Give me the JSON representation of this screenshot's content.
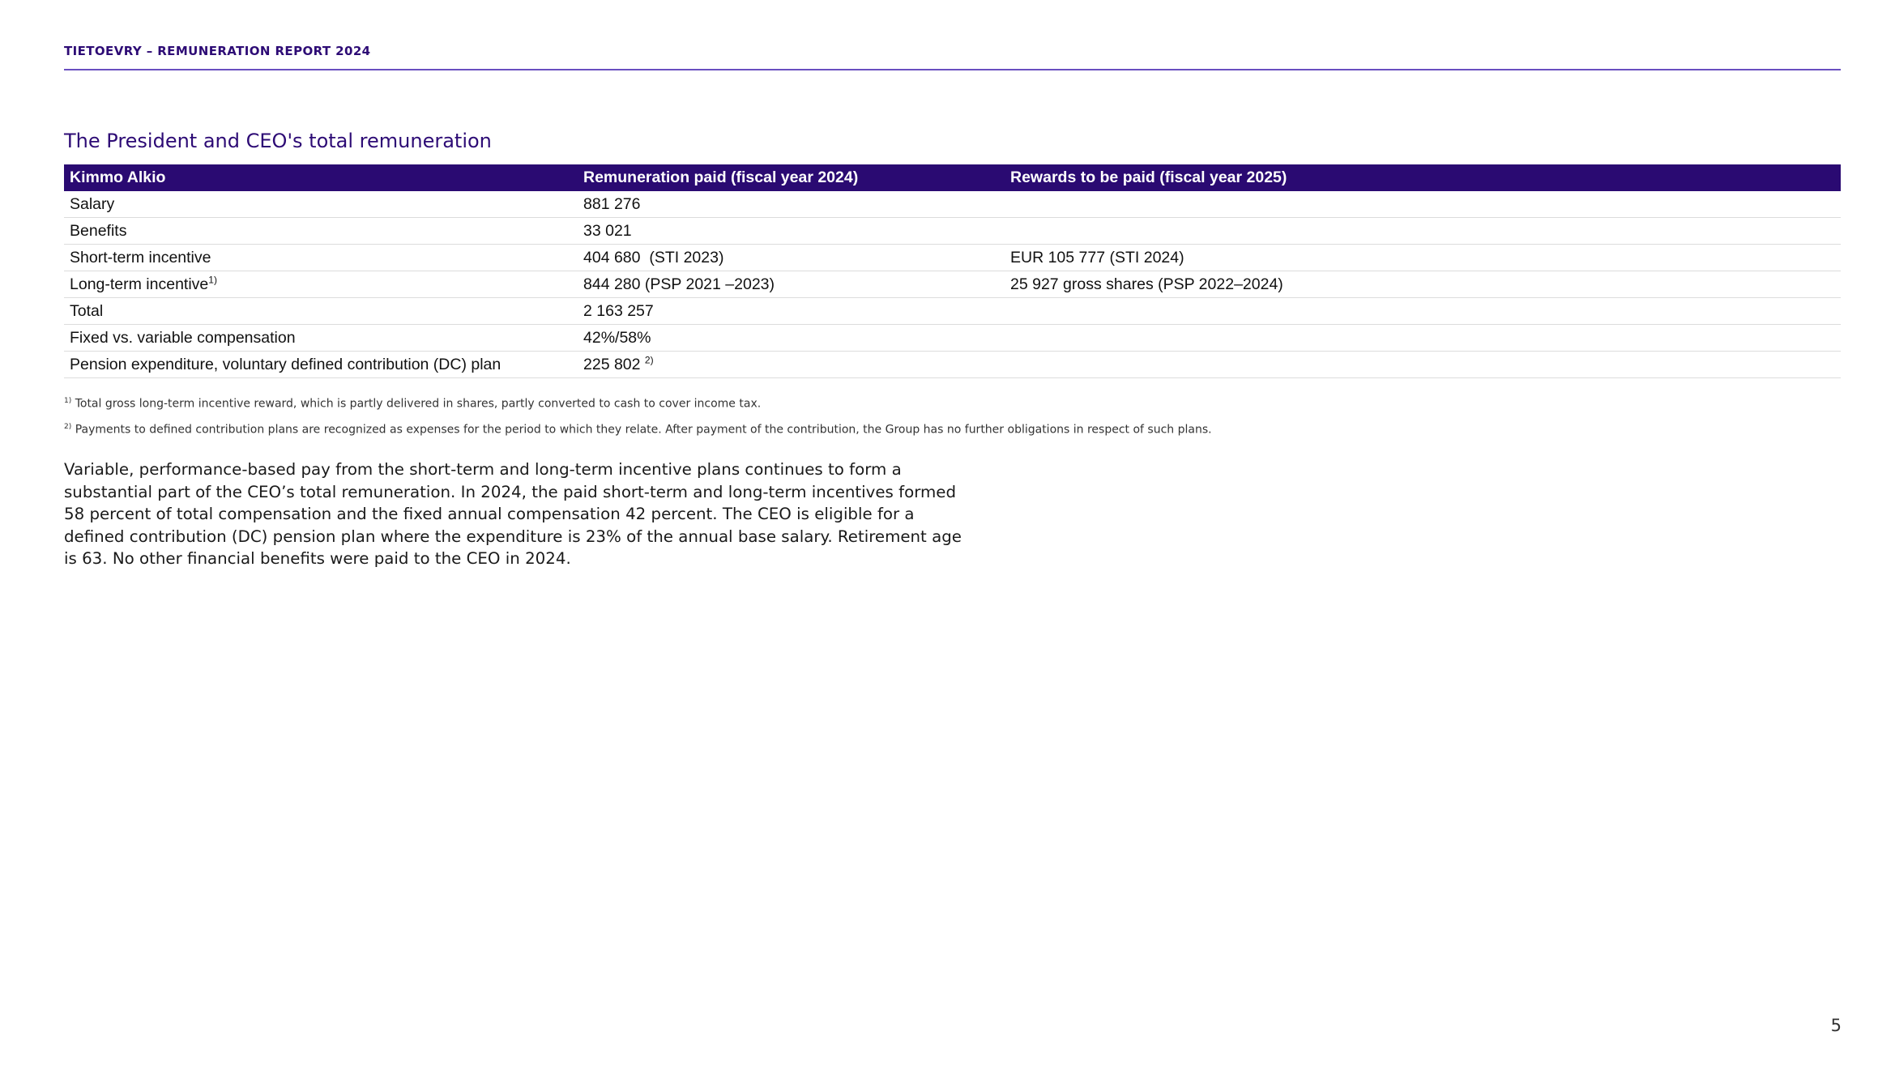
{
  "header": {
    "title": "TIETOEVRY – REMUNERATION REPORT 2024"
  },
  "section": {
    "title": "The President and CEO's total remuneration"
  },
  "table": {
    "headers": [
      "Kimmo Alkio",
      "Remuneration paid (fiscal year 2024)",
      "Rewards to be paid (fiscal year 2025)"
    ],
    "rows": [
      {
        "label": "Salary",
        "label_sup": "",
        "paid": "881 276",
        "paid_sup": "",
        "to_be_paid": ""
      },
      {
        "label": "Benefits",
        "label_sup": "",
        "paid": "33 021",
        "paid_sup": "",
        "to_be_paid": ""
      },
      {
        "label": "Short-term incentive",
        "label_sup": "",
        "paid": "404 680  (STI 2023)",
        "paid_sup": "",
        "to_be_paid": "EUR 105 777 (STI 2024)"
      },
      {
        "label": "Long-term incentive",
        "label_sup": "1)",
        "paid": "844 280 (PSP 2021 –2023)",
        "paid_sup": "",
        "to_be_paid": "25 927 gross shares (PSP 2022–2024)"
      },
      {
        "label": "Total",
        "label_sup": "",
        "paid": "2 163 257",
        "paid_sup": "",
        "to_be_paid": ""
      },
      {
        "label": "Fixed vs. variable compensation",
        "label_sup": "",
        "paid": "42%/58%",
        "paid_sup": "",
        "to_be_paid": ""
      },
      {
        "label": "Pension expenditure, voluntary defined contribution (DC) plan",
        "label_sup": "",
        "paid": "225 802",
        "paid_sup": "2)",
        "to_be_paid": ""
      }
    ]
  },
  "footnotes": [
    {
      "marker": "1)",
      "text": "Total gross long-term incentive reward, which is partly delivered in shares, partly converted to cash to cover income tax."
    },
    {
      "marker": "2)",
      "text": "Payments to defined contribution plans are recognized as expenses for the period to which they relate. After payment of the contribution, the Group has no further obligations in respect of such plans."
    }
  ],
  "body_text_lines": [
    "Variable, performance-based pay from the short-term and long-term incentive plans continues to form a",
    "substantial part of the CEO’s total remuneration. In 2024, the paid short-term and long-term incentives formed",
    "58 percent of total compensation and the fixed annual compensation 42 percent. The CEO is eligible for a",
    "defined contribution (DC) pension plan where the expenditure is 23% of the annual base salary. Retirement age",
    "is 63. No other financial benefits were paid to the CEO in 2024."
  ],
  "page_number": "5",
  "colors": {
    "brand_purple": "#2a0a72",
    "header_text": "#2d0b75",
    "rule": "#6a4fc0"
  }
}
